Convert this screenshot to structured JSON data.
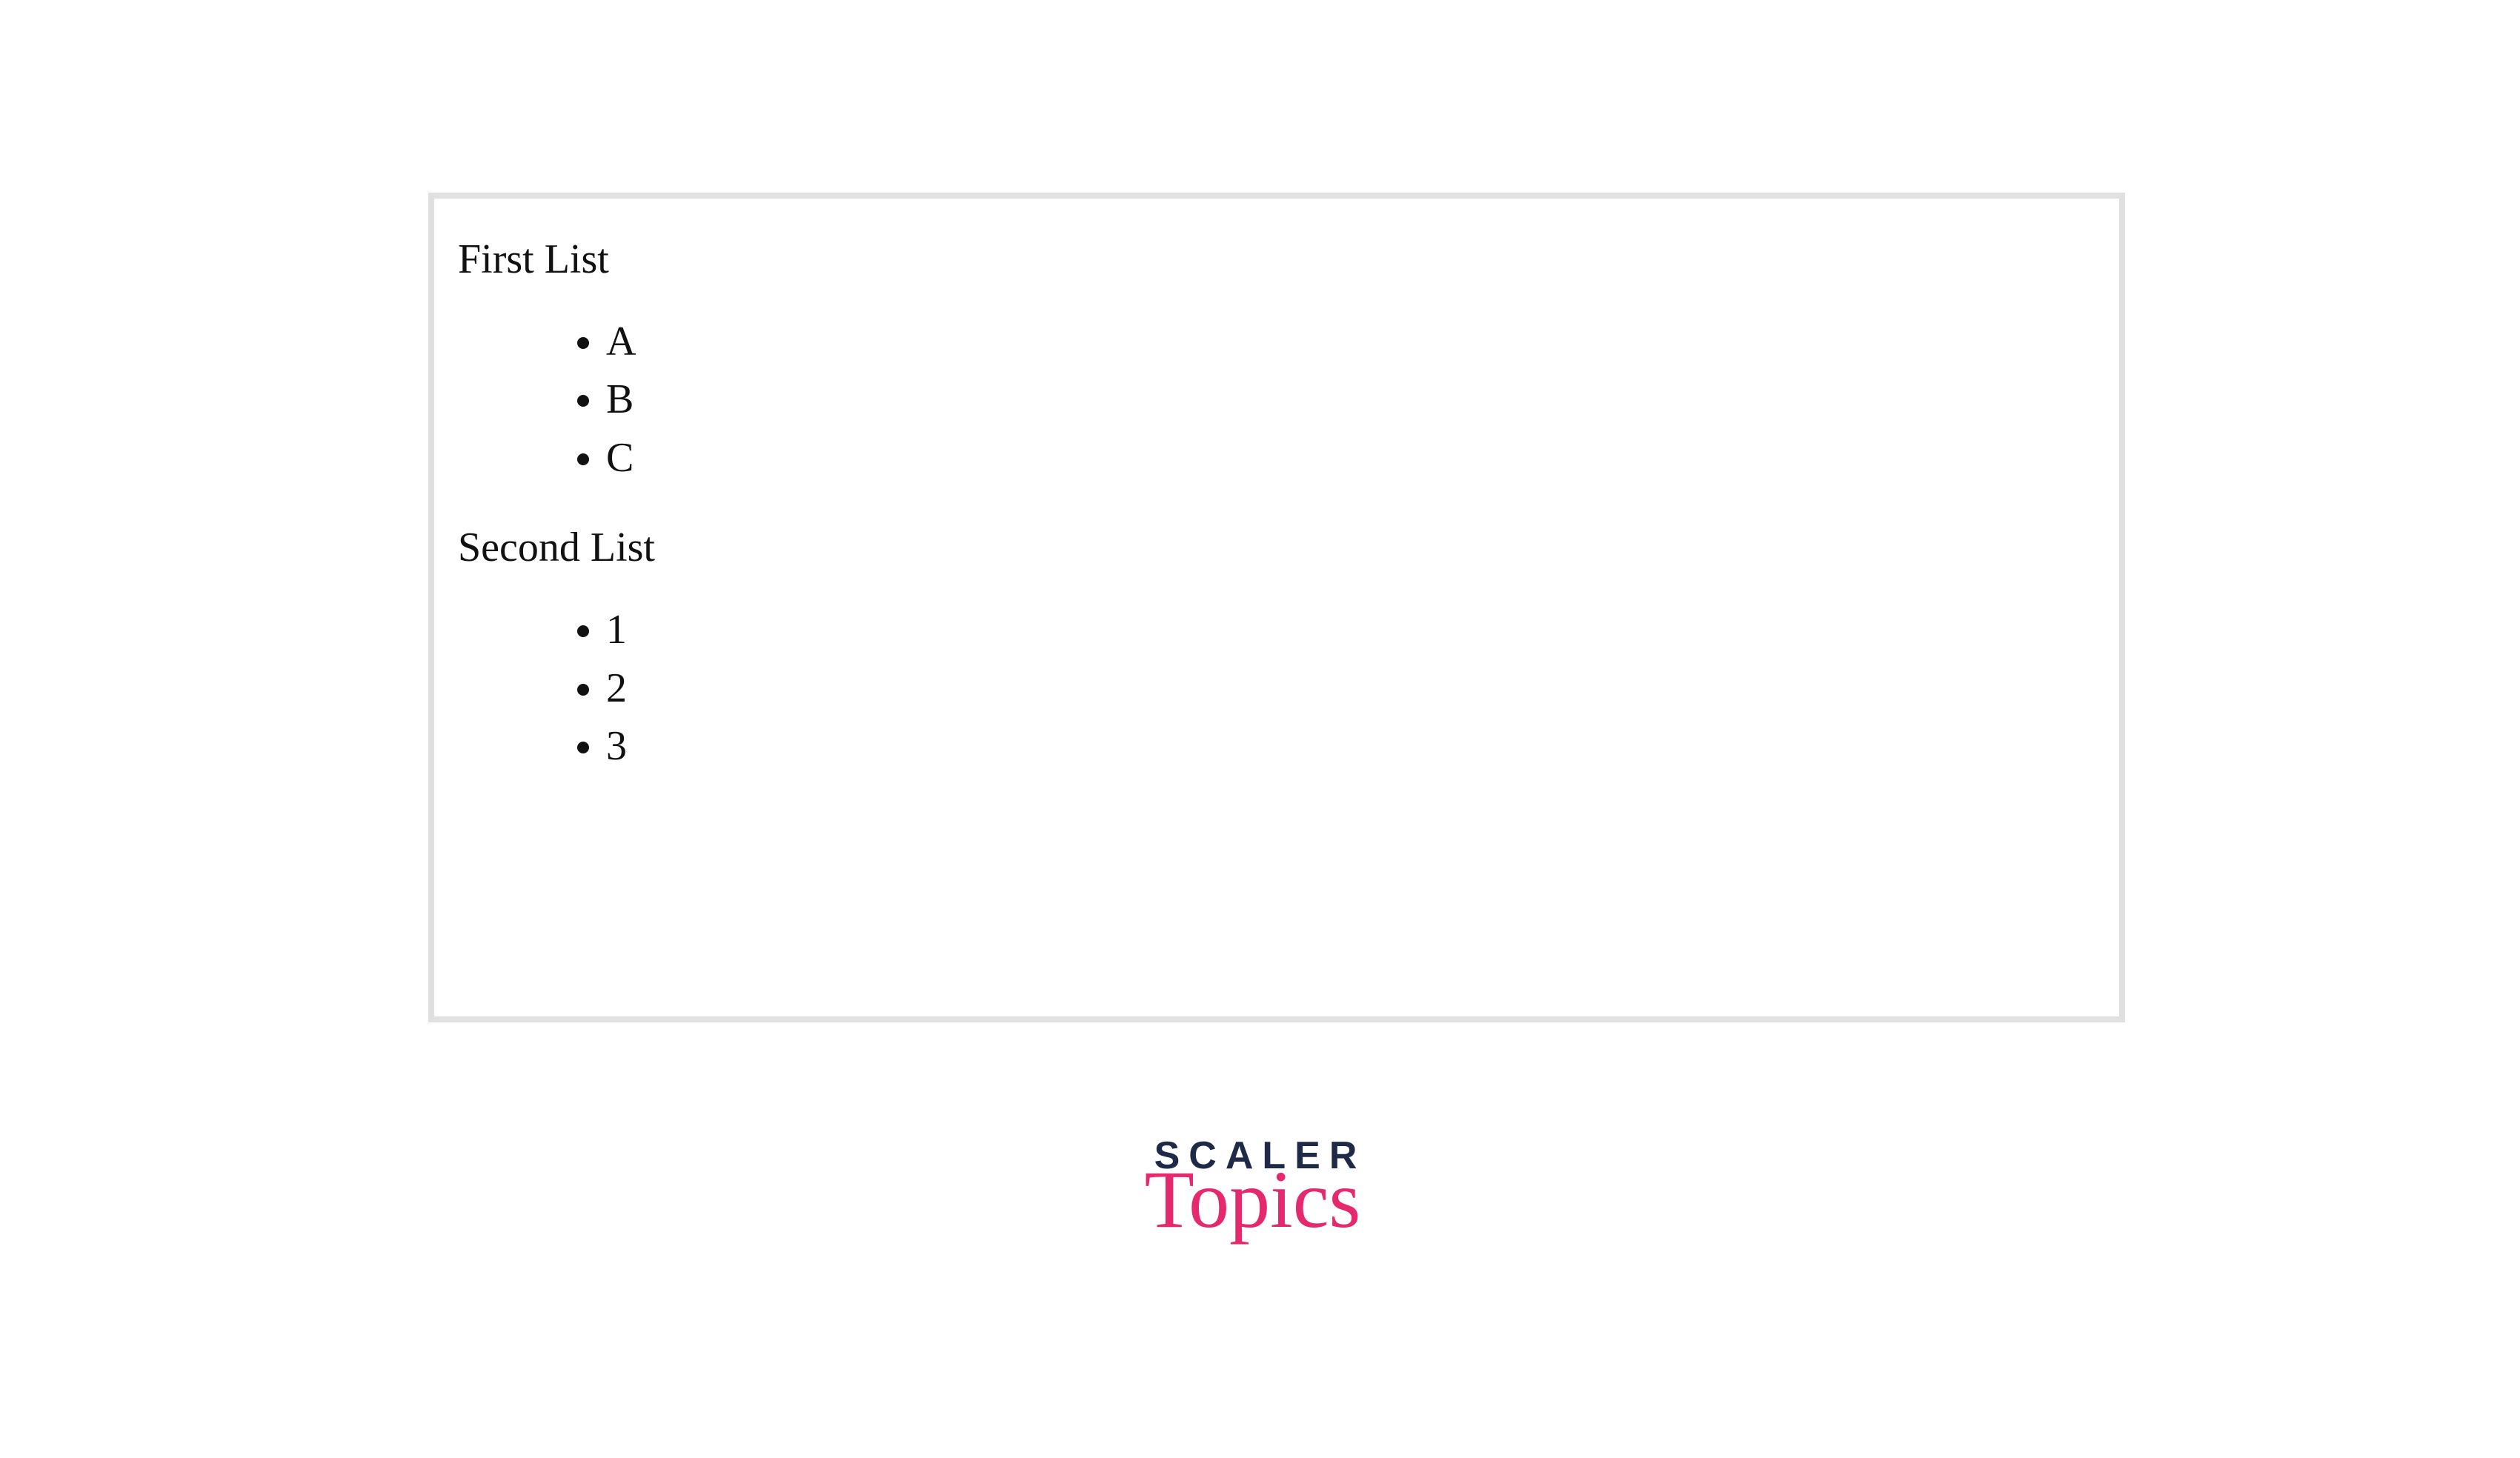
{
  "sections": [
    {
      "title": "First List",
      "items": [
        "A",
        "B",
        "C"
      ]
    },
    {
      "title": "Second List",
      "items": [
        "1",
        "2",
        "3"
      ]
    }
  ],
  "logo": {
    "line1": "SCALER",
    "line2": "Topics"
  }
}
